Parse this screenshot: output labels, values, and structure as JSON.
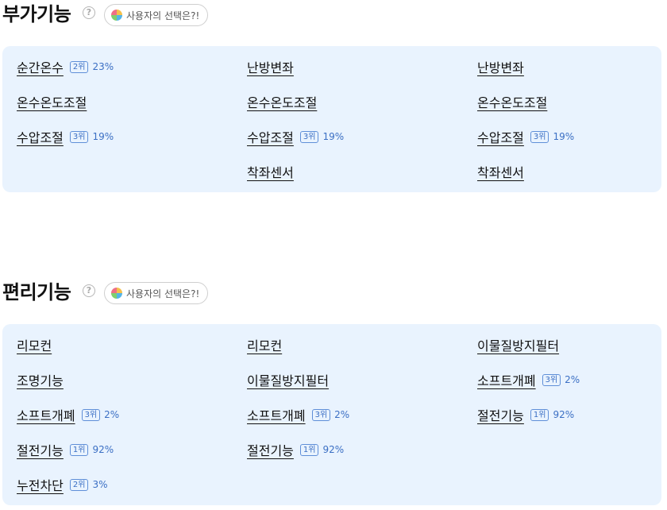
{
  "sections": [
    {
      "title": "부가기능",
      "help_icon": "?",
      "pill_label": "사용자의 선택은?!",
      "columns": [
        [
          {
            "name": "순간온수",
            "rank": "2위",
            "percent": "23%"
          },
          {
            "name": "온수온도조절"
          },
          {
            "name": "수압조절",
            "rank": "3위",
            "percent": "19%"
          }
        ],
        [
          {
            "name": "난방변좌"
          },
          {
            "name": "온수온도조절"
          },
          {
            "name": "수압조절",
            "rank": "3위",
            "percent": "19%"
          },
          {
            "name": "착좌센서"
          }
        ],
        [
          {
            "name": "난방변좌"
          },
          {
            "name": "온수온도조절"
          },
          {
            "name": "수압조절",
            "rank": "3위",
            "percent": "19%"
          },
          {
            "name": "착좌센서"
          }
        ]
      ]
    },
    {
      "title": "편리기능",
      "help_icon": "?",
      "pill_label": "사용자의 선택은?!",
      "columns": [
        [
          {
            "name": "리모컨"
          },
          {
            "name": "조명기능"
          },
          {
            "name": "소프트개폐",
            "rank": "3위",
            "percent": "2%"
          },
          {
            "name": "절전기능",
            "rank": "1위",
            "percent": "92%"
          },
          {
            "name": "누전차단",
            "rank": "2위",
            "percent": "3%"
          }
        ],
        [
          {
            "name": "리모컨"
          },
          {
            "name": "이물질방지필터"
          },
          {
            "name": "소프트개폐",
            "rank": "3위",
            "percent": "2%"
          },
          {
            "name": "절전기능",
            "rank": "1위",
            "percent": "92%"
          }
        ],
        [
          {
            "name": "이물질방지필터"
          },
          {
            "name": "소프트개폐",
            "rank": "3위",
            "percent": "2%"
          },
          {
            "name": "절전기능",
            "rank": "1위",
            "percent": "92%"
          }
        ]
      ]
    }
  ],
  "colors": {
    "panel_bg": "#e9f3fe",
    "rank_accent": "#3b6fc4"
  }
}
